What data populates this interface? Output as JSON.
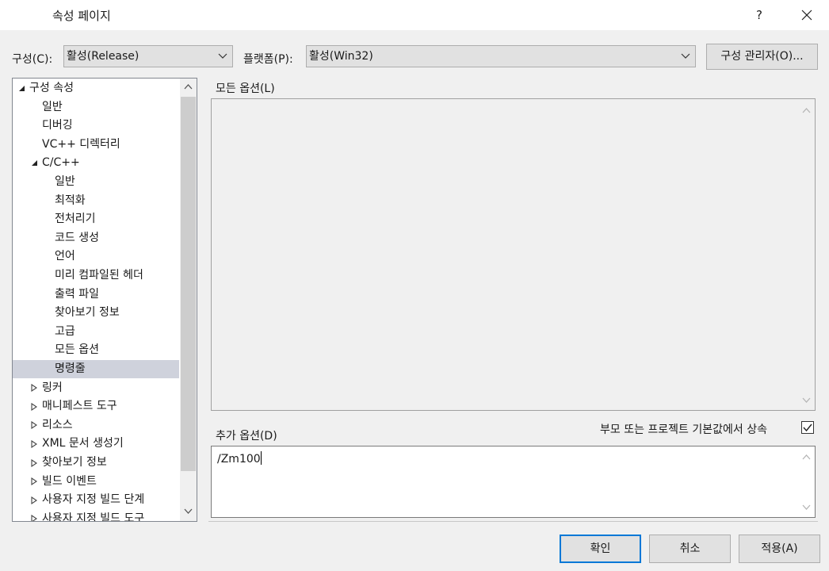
{
  "window": {
    "title": "속성 페이지",
    "help_label": "?"
  },
  "toolbar": {
    "config_label": "구성(C):",
    "config_value": "활성(Release)",
    "platform_label": "플랫폼(P):",
    "platform_value": "활성(Win32)",
    "config_manager_label": "구성 관리자(O)..."
  },
  "tree": {
    "items": [
      {
        "label": "구성 속성",
        "expander": "expanded"
      },
      {
        "label": "일반"
      },
      {
        "label": "디버깅"
      },
      {
        "label": "VC++ 디렉터리"
      },
      {
        "label": "C/C++",
        "expander": "expanded"
      },
      {
        "label": "일반"
      },
      {
        "label": "최적화"
      },
      {
        "label": "전처리기"
      },
      {
        "label": "코드 생성"
      },
      {
        "label": "언어"
      },
      {
        "label": "미리 컴파일된 헤더"
      },
      {
        "label": "출력 파일"
      },
      {
        "label": "찾아보기 정보"
      },
      {
        "label": "고급"
      },
      {
        "label": "모든 옵션"
      },
      {
        "label": "명령줄",
        "selected": true
      },
      {
        "label": "링커",
        "expander": "collapsed"
      },
      {
        "label": "매니페스트 도구",
        "expander": "collapsed"
      },
      {
        "label": "리소스",
        "expander": "collapsed"
      },
      {
        "label": "XML 문서 생성기",
        "expander": "collapsed"
      },
      {
        "label": "찾아보기 정보",
        "expander": "collapsed"
      },
      {
        "label": "빌드 이벤트",
        "expander": "collapsed"
      },
      {
        "label": "사용자 지정 빌드 단계",
        "expander": "collapsed"
      },
      {
        "label": "사용자 지정 빌드 도구",
        "expander": "collapsed"
      }
    ]
  },
  "main": {
    "all_options_label": "모든 옵션(L)",
    "all_options_value": "",
    "additional_options_label": "추가 옵션(D)",
    "inherit_label": "부모 또는 프로젝트 기본값에서 상속",
    "inherit_checked": true,
    "additional_options_value": "/Zm100"
  },
  "footer": {
    "ok_label": "확인",
    "cancel_label": "취소",
    "apply_label": "적용(A)"
  },
  "colors": {
    "accent": "#0078d7",
    "selection": "#cfd2dc"
  }
}
